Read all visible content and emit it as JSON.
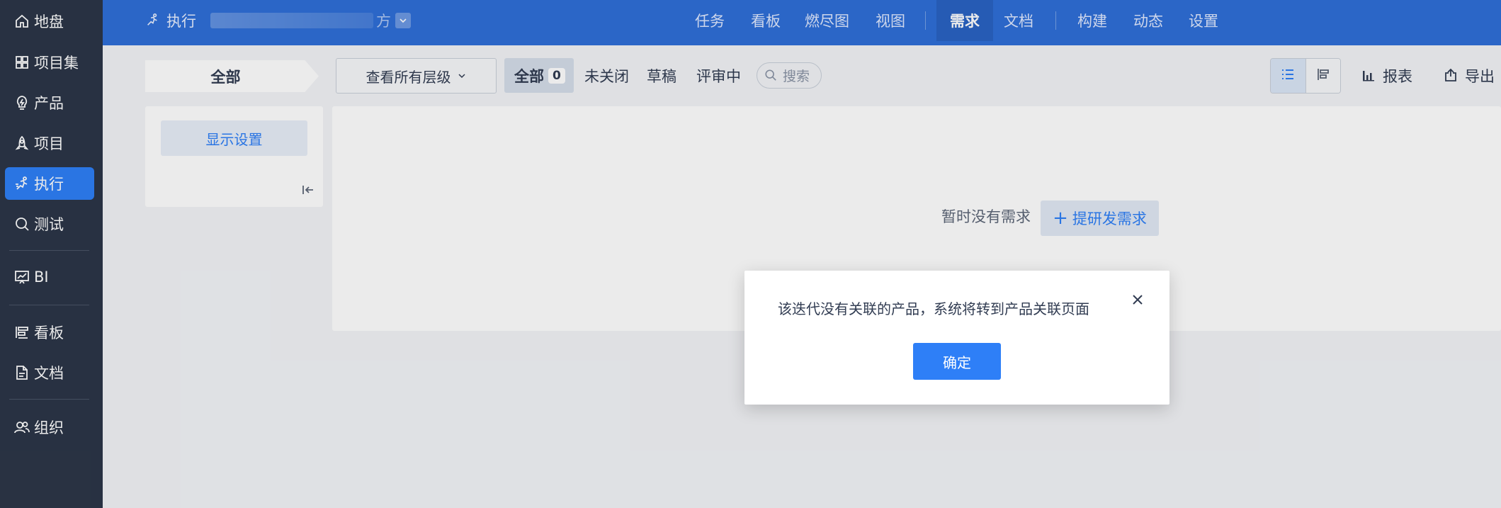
{
  "sidebar": {
    "items": [
      {
        "label": "地盘",
        "icon": "home-icon"
      },
      {
        "label": "项目集",
        "icon": "grid-icon"
      },
      {
        "label": "产品",
        "icon": "bulb-icon"
      },
      {
        "label": "项目",
        "icon": "rocket-icon"
      },
      {
        "label": "执行",
        "icon": "run-icon",
        "active": true
      },
      {
        "label": "测试",
        "icon": "magnifier-icon"
      },
      {
        "label": "BI",
        "icon": "chart-board-icon"
      },
      {
        "label": "看板",
        "icon": "kanban-icon"
      },
      {
        "label": "文档",
        "icon": "document-icon"
      },
      {
        "label": "组织",
        "icon": "users-icon"
      }
    ]
  },
  "topbar": {
    "breadcrumb_label": "执行",
    "breadcrumb_suffix": "方",
    "nav": [
      "任务",
      "看板",
      "燃尽图",
      "视图",
      "需求",
      "文档",
      "构建",
      "动态",
      "设置"
    ],
    "active_nav": "需求"
  },
  "toolbar": {
    "tab_all": "全部",
    "level_select": "查看所有层级",
    "filters": {
      "all": "全部",
      "all_count": "0",
      "unclosed": "未关闭",
      "draft": "草稿",
      "reviewing": "评审中"
    },
    "search_placeholder": "搜索",
    "report_label": "报表",
    "export_label": "导出"
  },
  "left_panel": {
    "display_settings": "显示设置"
  },
  "main": {
    "empty_text": "暂时没有需求",
    "create_button": "提研发需求"
  },
  "modal": {
    "message": "该迭代没有关联的产品，系统将转到产品关联页面",
    "ok_label": "确定"
  },
  "colors": {
    "sidebar_bg": "#2c3648",
    "topbar_bg": "#2f6fd8",
    "accent": "#2e7ff7"
  }
}
